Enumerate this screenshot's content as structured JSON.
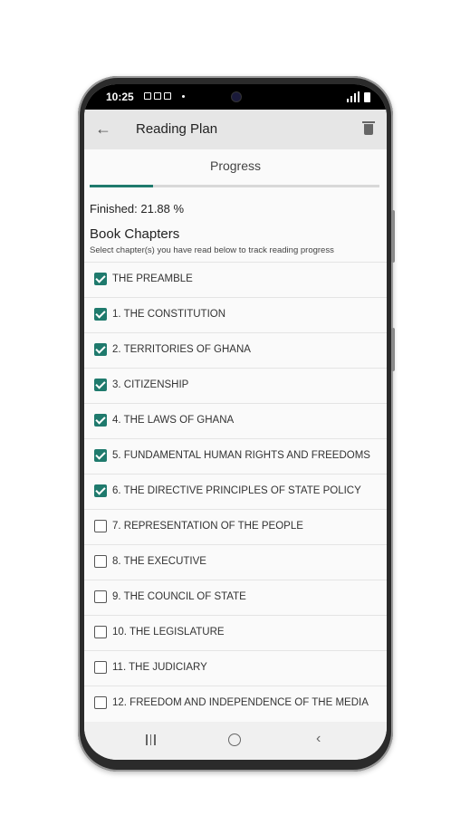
{
  "status": {
    "time": "10:25"
  },
  "appbar": {
    "title": "Reading Plan"
  },
  "progress": {
    "label": "Progress",
    "fraction": 0.2188
  },
  "finished_text": "Finished: 21.88 %",
  "book": {
    "title": "Book Chapters",
    "subtitle": "Select chapter(s) you have read below to track reading progress"
  },
  "chapters": [
    {
      "label": "THE PREAMBLE",
      "checked": true
    },
    {
      "label": "1. THE CONSTITUTION",
      "checked": true
    },
    {
      "label": "2. TERRITORIES OF GHANA",
      "checked": true
    },
    {
      "label": "3. CITIZENSHIP",
      "checked": true
    },
    {
      "label": "4. THE LAWS OF GHANA",
      "checked": true
    },
    {
      "label": "5. FUNDAMENTAL HUMAN RIGHTS AND FREEDOMS",
      "checked": true
    },
    {
      "label": "6. THE DIRECTIVE PRINCIPLES OF STATE POLICY",
      "checked": true
    },
    {
      "label": "7. REPRESENTATION OF THE PEOPLE",
      "checked": false
    },
    {
      "label": "8. THE EXECUTIVE",
      "checked": false
    },
    {
      "label": "9. THE COUNCIL OF STATE",
      "checked": false
    },
    {
      "label": "10. THE LEGISLATURE",
      "checked": false
    },
    {
      "label": "11. THE JUDICIARY",
      "checked": false
    },
    {
      "label": "12. FREEDOM AND INDEPENDENCE OF THE MEDIA",
      "checked": false
    }
  ],
  "colors": {
    "accent": "#1f7a6d",
    "appbar": "#e6e6e6"
  },
  "icons": {
    "back": "arrow-left-icon",
    "delete": "trash-icon"
  }
}
